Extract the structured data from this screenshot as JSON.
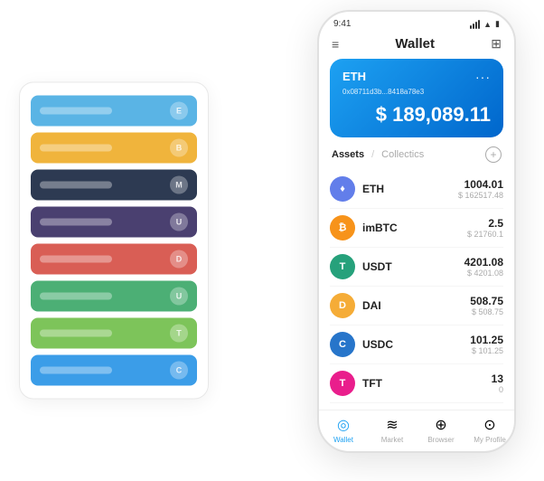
{
  "scene": {
    "card_stack": {
      "cards": [
        {
          "color": "#5ab4e5",
          "dot_label": "E"
        },
        {
          "color": "#f0b43c",
          "dot_label": "B"
        },
        {
          "color": "#2d3a52",
          "dot_label": "M"
        },
        {
          "color": "#4a4070",
          "dot_label": "U"
        },
        {
          "color": "#d95e55",
          "dot_label": "D"
        },
        {
          "color": "#4caf75",
          "dot_label": "U"
        },
        {
          "color": "#7dc45a",
          "dot_label": "T"
        },
        {
          "color": "#3b9de8",
          "dot_label": "C"
        }
      ]
    },
    "phone": {
      "status_bar": {
        "time": "9:41",
        "icons": [
          "signal",
          "wifi",
          "battery"
        ]
      },
      "header": {
        "title": "Wallet"
      },
      "eth_card": {
        "name": "ETH",
        "address": "0x08711d3b...8418a78e3",
        "balance": "$ 189,089.11"
      },
      "assets_section": {
        "tab_active": "Assets",
        "tab_divider": "/",
        "tab_inactive": "Collectics",
        "add_label": "+"
      },
      "assets": [
        {
          "symbol": "ETH",
          "amount": "1004.01",
          "usd": "$ 162517.48",
          "color": "#627eea",
          "letter": "♦"
        },
        {
          "symbol": "imBTC",
          "amount": "2.5",
          "usd": "$ 21760.1",
          "color": "#f7931a",
          "letter": "₿"
        },
        {
          "symbol": "USDT",
          "amount": "4201.08",
          "usd": "$ 4201.08",
          "color": "#26a17b",
          "letter": "T"
        },
        {
          "symbol": "DAI",
          "amount": "508.75",
          "usd": "$ 508.75",
          "color": "#f5ac37",
          "letter": "D"
        },
        {
          "symbol": "USDC",
          "amount": "101.25",
          "usd": "$ 101.25",
          "color": "#2775ca",
          "letter": "C"
        },
        {
          "symbol": "TFT",
          "amount": "13",
          "usd": "0",
          "color": "#e91e8c",
          "letter": "T"
        }
      ],
      "nav": [
        {
          "label": "Wallet",
          "icon": "◎",
          "active": true
        },
        {
          "label": "Market",
          "icon": "📊",
          "active": false
        },
        {
          "label": "Browser",
          "icon": "🌐",
          "active": false
        },
        {
          "label": "My Profile",
          "icon": "👤",
          "active": false
        }
      ]
    }
  }
}
